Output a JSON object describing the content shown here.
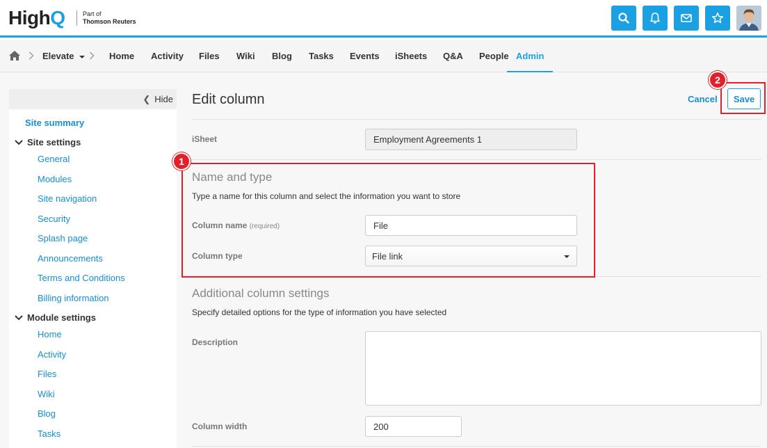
{
  "brand": {
    "logo_text_a": "High",
    "logo_text_b": "Q",
    "tagline_line1": "Part of",
    "tagline_line2": "Thomson Reuters",
    "accent_color": "#1ba1e2"
  },
  "header": {
    "icons": [
      "search-icon",
      "bell-icon",
      "mail-icon",
      "star-icon"
    ]
  },
  "nav": {
    "site": "Elevate",
    "items": [
      {
        "label": "Home"
      },
      {
        "label": "Activity"
      },
      {
        "label": "Files"
      },
      {
        "label": "Wiki"
      },
      {
        "label": "Blog"
      },
      {
        "label": "Tasks"
      },
      {
        "label": "Events"
      },
      {
        "label": "iSheets"
      },
      {
        "label": "Q&A"
      },
      {
        "label": "People"
      },
      {
        "label": "Admin"
      }
    ]
  },
  "sidebar": {
    "hide_label": "Hide",
    "site_summary": "Site summary",
    "site_settings_label": "Site settings",
    "site_settings": [
      "General",
      "Modules",
      "Site navigation",
      "Security",
      "Splash page",
      "Announcements",
      "Terms and Conditions",
      "Billing information"
    ],
    "module_settings_label": "Module settings",
    "module_settings": [
      "Home",
      "Activity",
      "Files",
      "Wiki",
      "Blog",
      "Tasks"
    ]
  },
  "page": {
    "title": "Edit column",
    "cancel_label": "Cancel",
    "save_label": "Save",
    "isheet_label": "iSheet",
    "isheet_value": "Employment Agreements 1",
    "name_type_title": "Name and type",
    "name_type_desc": "Type a name for this column and select the information you want to store",
    "column_name_label": "Column name",
    "required_label": "(required)",
    "column_name_value": "File",
    "column_type_label": "Column type",
    "column_type_value": "File link",
    "additional_title": "Additional column settings",
    "additional_desc": "Specify detailed options for the type of information you have selected",
    "description_label": "Description",
    "description_value": "",
    "column_width_label": "Column width",
    "column_width_value": "200"
  },
  "annotations": {
    "badge1": "1",
    "badge2": "2",
    "color": "#e0202a"
  }
}
